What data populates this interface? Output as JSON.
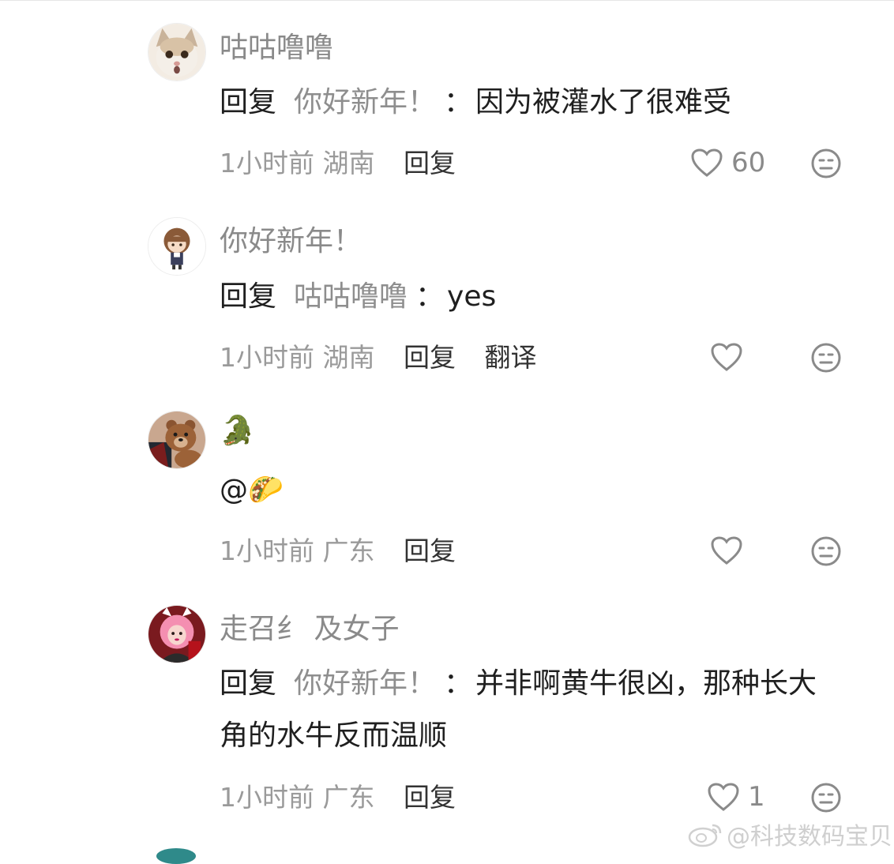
{
  "comments": [
    {
      "username": "咕咕噜噜",
      "reply_keyword": "回复",
      "reply_to": "你好新年！",
      "separator": "：",
      "text": "因为被灌水了很难受",
      "time": "1小时前",
      "location": "湖南",
      "reply_action": "回复",
      "like_count": "60",
      "avatar_icon": "cat-avatar"
    },
    {
      "username": "你好新年！",
      "reply_keyword": "回复",
      "reply_to": "咕咕噜噜",
      "separator": "：",
      "text": "yes",
      "time": "1小时前",
      "location": "湖南",
      "reply_action": "回复",
      "translate_action": "翻译",
      "like_count": "",
      "avatar_icon": "anime-girl-avatar"
    },
    {
      "username": "🐊",
      "mention": "@🌮",
      "time": "1小时前",
      "location": "广东",
      "reply_action": "回复",
      "like_count": "",
      "avatar_icon": "bear-avatar"
    },
    {
      "username": "走召纟 及女子",
      "reply_keyword": "回复",
      "reply_to": "你好新年！",
      "separator": "：",
      "text": "并非啊黄牛很凶，那种长大角的水牛反而温顺",
      "time": "1小时前",
      "location": "广东",
      "reply_action": "回复",
      "like_count": "1",
      "avatar_icon": "pink-hair-avatar"
    }
  ],
  "watermark": "@科技数码宝贝",
  "icons": {
    "like": "heart-outline-icon",
    "dislike": "neutral-face-icon",
    "watermark_logo": "weibo-logo-icon"
  },
  "colors": {
    "username": "#8a8a8a",
    "body": "#1f1f1f",
    "meta": "#9a9a9a"
  }
}
